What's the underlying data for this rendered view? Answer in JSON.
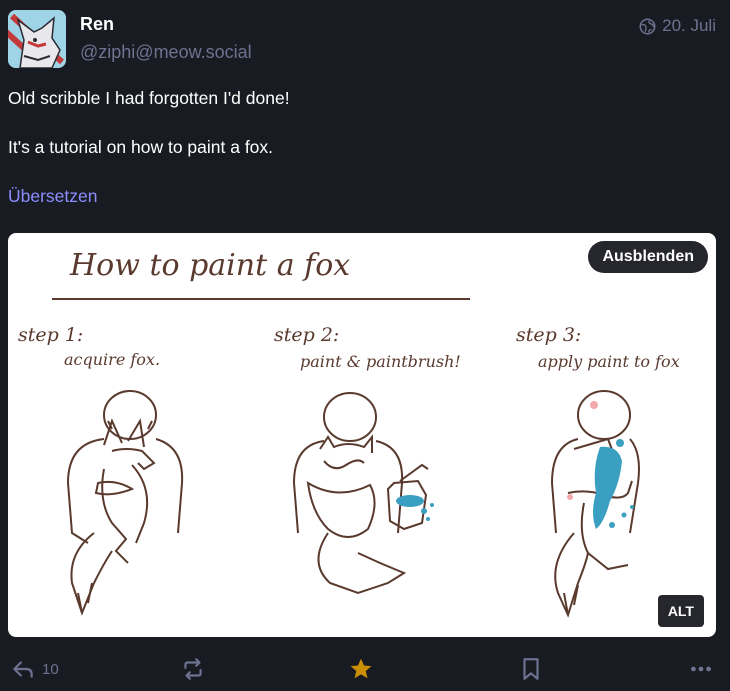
{
  "author": {
    "display_name": "Ren",
    "handle": "@ziphi@meow.social",
    "avatar_icon": "fox-avatar"
  },
  "post": {
    "date": "20. Juli",
    "visibility_icon": "globe-icon",
    "paragraphs": [
      "Old scribble I had forgotten I'd done!",
      "It's a tutorial on how to paint a fox."
    ],
    "translate_label": "Übersetzen"
  },
  "media": {
    "hide_label": "Ausblenden",
    "alt_label": "ALT",
    "title": "How to paint a fox",
    "steps": [
      {
        "heading": "step 1:",
        "caption": "acquire fox."
      },
      {
        "heading": "step 2:",
        "caption": "paint & paintbrush!"
      },
      {
        "heading": "step 3:",
        "caption": "apply paint to fox"
      }
    ]
  },
  "actions": {
    "reply_count": "10",
    "reply_icon": "reply-icon",
    "boost_icon": "boost-icon",
    "favourite_icon": "star-icon",
    "bookmark_icon": "bookmark-icon",
    "more_icon": "more-icon"
  },
  "colors": {
    "background": "#191b22",
    "handle": "#6d7290",
    "link": "#8c8dff",
    "favourited": "#ca8f04",
    "ink": "#5a3a2e",
    "paint": "#3a9fc0"
  }
}
